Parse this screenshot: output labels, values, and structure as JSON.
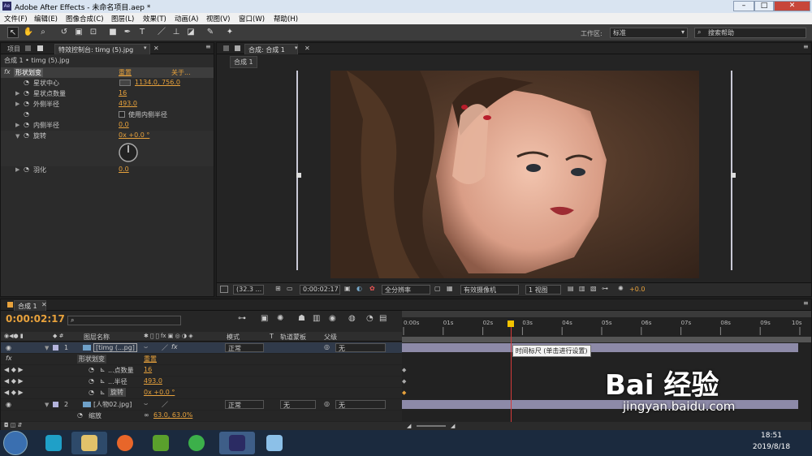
{
  "window": {
    "title": "Adobe After Effects - 未命名项目.aep *",
    "app_icon": "Ae"
  },
  "menu": [
    "文件(F)",
    "编辑(E)",
    "图像合成(C)",
    "图层(L)",
    "效果(T)",
    "动画(A)",
    "视图(V)",
    "窗口(W)",
    "帮助(H)"
  ],
  "toolbar": {
    "workspace_label": "工作区:",
    "workspace_value": "标准",
    "search_placeholder": "搜索帮助"
  },
  "left_panel": {
    "tab_project": "项目",
    "tab_effects": "特效控制台: timg (5).jpg",
    "breadcrumb": "合成 1 • timg (5).jpg",
    "effect_name": "形状划变",
    "reset": "重置",
    "about": "关于...",
    "props": [
      {
        "name": "星状中心",
        "value": "1134.0, 756.0"
      },
      {
        "name": "星状点数量",
        "value": "16"
      },
      {
        "name": "外侧半径",
        "value": "493.0"
      },
      {
        "name": "",
        "value": "使用内侧半径"
      },
      {
        "name": "内侧半径",
        "value": "0.0"
      },
      {
        "name": "旋转",
        "value": "0x +0.0 °"
      },
      {
        "name": "羽化",
        "value": "0.0"
      }
    ]
  },
  "comp_panel": {
    "tab": "合成: 合成 1",
    "subtab": "合成 1",
    "zoom": "(32.3 ...",
    "timecode": "0:00:02:17",
    "resolution": "全分辨率",
    "camera": "有效摄像机",
    "views": "1 视图",
    "exposure": "+0.0"
  },
  "timeline": {
    "tab": "合成 1",
    "timecode": "0:00:02:17",
    "headers": {
      "layer_name": "图层名称",
      "mode": "模式",
      "t": "T",
      "trkmat": "轨道蒙板",
      "parent": "父级"
    },
    "ruler": [
      "0:00s",
      "01s",
      "02s",
      "03s",
      "04s",
      "05s",
      "06s",
      "07s",
      "08s",
      "09s",
      "10s"
    ],
    "tooltip": "时间标尺 (单击进行设置)",
    "layers": [
      {
        "num": "1",
        "name": "[timg (...pg]",
        "mode": "正常",
        "parent": "无"
      },
      {
        "num": "2",
        "name": "[人物02.jpg]",
        "mode": "正常",
        "trkmat": "无",
        "parent": "无"
      }
    ],
    "sub_rows": [
      {
        "name": "形状划变",
        "value": "重置"
      },
      {
        "name": "...点数量",
        "value": "16"
      },
      {
        "name": "...半径",
        "value": "493.0"
      },
      {
        "name": "旋转",
        "value": "0x +0.0 °"
      }
    ],
    "scale_row": {
      "name": "缩放",
      "value": "63.0, 63.0%"
    },
    "playhead_fraction": 0.27
  },
  "taskbar": {
    "time": "18:51",
    "date": "2019/8/18"
  },
  "watermark": {
    "brand": "Bai 经验",
    "url": "jingyan.baidu.com"
  },
  "colors": {
    "accent_orange": "#e8a23c",
    "layer_bar": "#8d8aa8",
    "playhead": "#d33a3a"
  }
}
